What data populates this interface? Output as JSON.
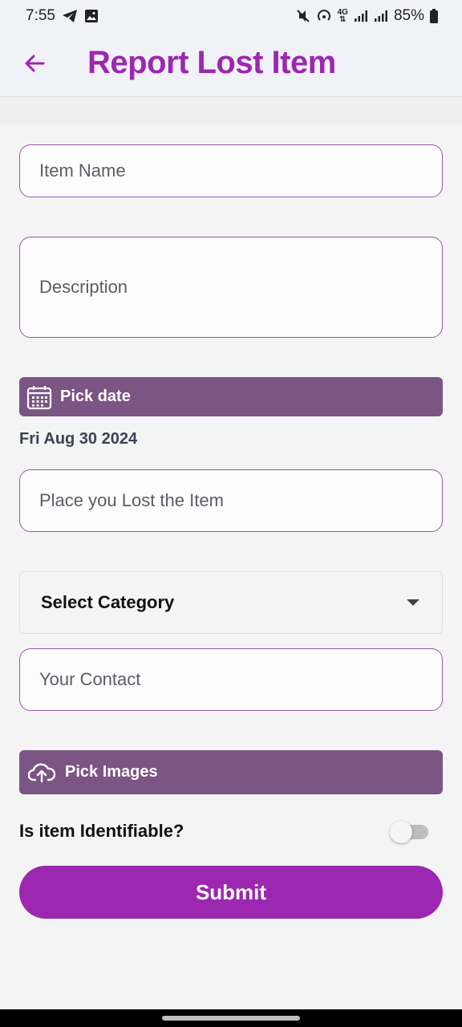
{
  "status_bar": {
    "time": "7:55",
    "battery": "85%",
    "network": "4G"
  },
  "app_bar": {
    "title": "Report Lost Item"
  },
  "form": {
    "item_name_placeholder": "Item Name",
    "description_placeholder": "Description",
    "pick_date_label": "Pick date",
    "selected_date": "Fri Aug 30 2024",
    "place_placeholder": "Place you Lost the Item",
    "category_label": "Select Category",
    "contact_placeholder": "Your Contact",
    "pick_images_label": "Pick Images",
    "identifiable_label": "Is item Identifiable?",
    "identifiable_on": false,
    "submit_label": "Submit"
  },
  "colors": {
    "primary": "#9c27b0",
    "button_secondary": "#7b5583",
    "field_border": "#9b56a8"
  }
}
